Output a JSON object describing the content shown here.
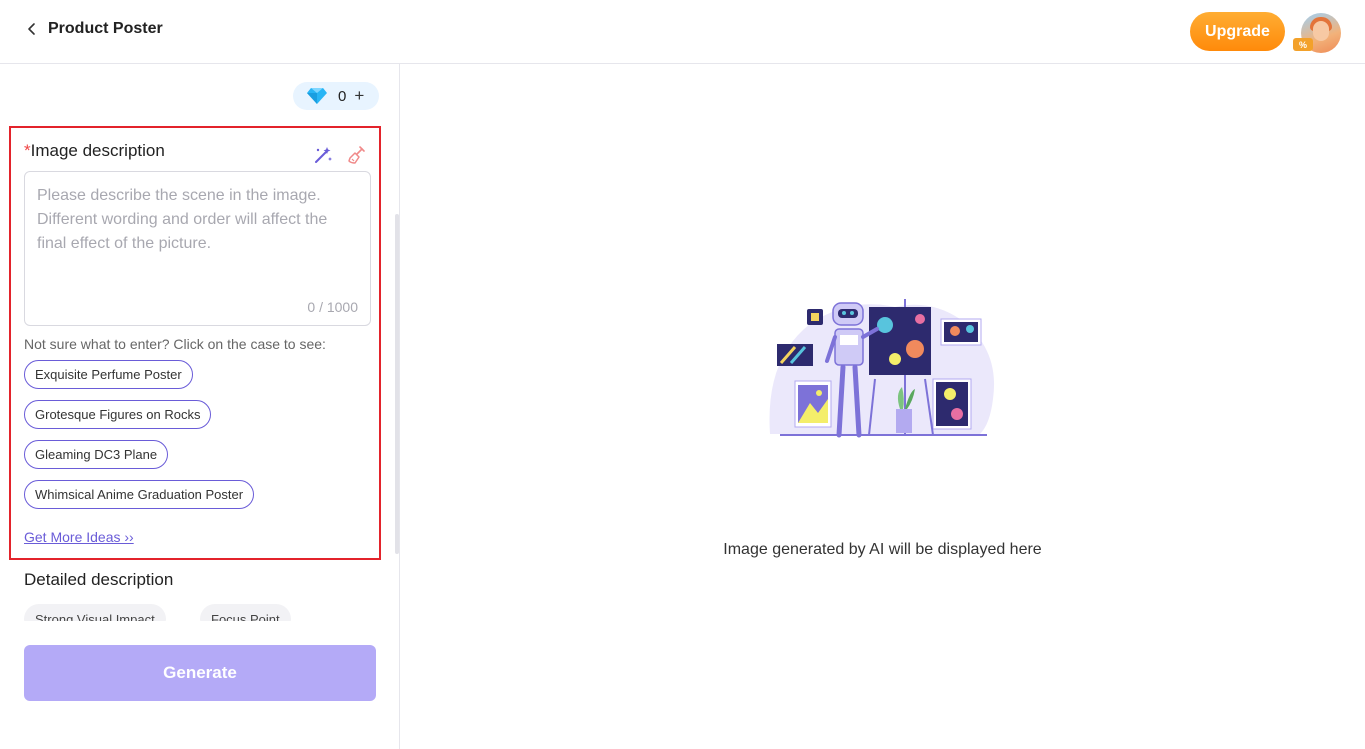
{
  "header": {
    "back_title": "Product Poster",
    "upgrade_label": "Upgrade",
    "avatar_badge": "%"
  },
  "credits": {
    "count": "0",
    "plus": "+"
  },
  "image_description": {
    "required_mark": "*",
    "label": "Image description",
    "placeholder": "Please describe the scene in the image. Different wording and order will affect the final effect of the picture.",
    "value": "",
    "counter": "0 / 1000",
    "hint": "Not sure what to enter? Click on the case to see:",
    "examples": [
      "Exquisite Perfume Poster",
      "Grotesque Figures on Rocks",
      "Gleaming DC3 Plane",
      "Whimsical Anime Graduation Poster"
    ],
    "more_ideas": "Get More Ideas ››"
  },
  "detailed_description": {
    "label": "Detailed description",
    "tags": [
      "Strong Visual Impact",
      "Focus Point"
    ]
  },
  "generate_label": "Generate",
  "result": {
    "empty_text": "Image generated by AI will be displayed here"
  },
  "colors": {
    "accent": "#6a5cd8",
    "upgrade": "#ff8a0a",
    "generate_disabled": "#b4aaf7",
    "highlight": "#e3232b"
  }
}
